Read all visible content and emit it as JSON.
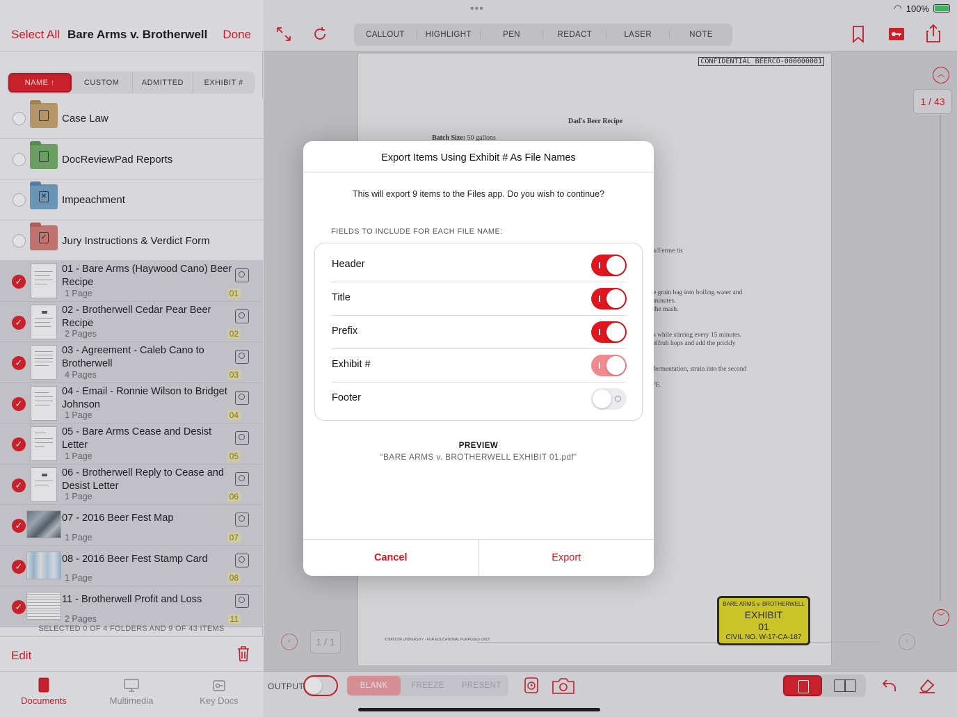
{
  "sidebar": {
    "select_all": "Select All",
    "title": "Bare Arms v. Brotherwell",
    "done": "Done",
    "sort_tabs": [
      "NAME ↑",
      "CUSTOM",
      "ADMITTED",
      "EXHIBIT #"
    ],
    "folders": [
      {
        "name": "Case Law",
        "color": "#c9a46a",
        "icon": "book-icon"
      },
      {
        "name": "DocReviewPad Reports",
        "color": "#6fae62",
        "icon": "report-icon"
      },
      {
        "name": "Impeachment",
        "color": "#6ea3c9",
        "icon": "x-box-icon"
      },
      {
        "name": "Jury Instructions & Verdict Form",
        "color": "#d77a74",
        "icon": "checkbox-icon"
      }
    ],
    "documents": [
      {
        "title": "01 - Bare Arms (Haywood Cano) Beer Recipe",
        "pages": "1 Page",
        "exhibit": "01"
      },
      {
        "title": "02 - Brotherwell Cedar Pear Beer Recipe",
        "pages": "2 Pages",
        "exhibit": "02"
      },
      {
        "title": "03 - Agreement - Caleb Cano to Brotherwell",
        "pages": "4 Pages",
        "exhibit": "03"
      },
      {
        "title": "04 - Email - Ronnie Wilson to Bridget Johnson",
        "pages": "1 Page",
        "exhibit": "04"
      },
      {
        "title": "05 - Bare Arms Cease and Desist Letter",
        "pages": "1 Page",
        "exhibit": "05"
      },
      {
        "title": "06 - Brotherwell Reply to Cease and Desist Letter",
        "pages": "1 Page",
        "exhibit": "06"
      },
      {
        "title": "07 - 2016 Beer Fest Map",
        "pages": "1 Page",
        "exhibit": "07"
      },
      {
        "title": "08 - 2016 Beer Fest Stamp Card",
        "pages": "1 Page",
        "exhibit": "08"
      },
      {
        "title": "11 - Brotherwell Profit and Loss",
        "pages": "2 Pages",
        "exhibit": "11"
      }
    ],
    "selection_status": "SELECTED 0 OF 4 FOLDERS AND 9 OF 43 ITEMS",
    "edit": "Edit",
    "tabs": [
      "Documents",
      "Multimedia",
      "Key Docs"
    ]
  },
  "status_bar": {
    "battery": "100%"
  },
  "toolbar": {
    "tools": [
      "CALLOUT",
      "HIGHLIGHT",
      "PEN",
      "REDACT",
      "LASER",
      "NOTE"
    ]
  },
  "document": {
    "confidential": "CONFIDENTIAL BEERCO-000000001",
    "title": "Dad's Beer Recipe",
    "batch_label": "Batch Size:",
    "batch_value": "50 gallons",
    "fragments": [
      "ps/Ferme  tis",
      "e grain bag into boiling water and",
      "minutes.",
      "the mash.",
      "s while stirring every 15 minutes.",
      "elfruh hops and add the prickly",
      "fermentation, strain into the second",
      "°F."
    ],
    "footer": "© BAYLOR UNIVERSITY - FOR EDUCATIONAL PURPOSES ONLY",
    "stamp": {
      "line1": "BARE ARMS v. BROTHERWELL",
      "line2": "EXHIBIT",
      "line3": "01",
      "line4": "CIVIL NO. W-17-CA-187"
    }
  },
  "viewer": {
    "page_count": "1 / 43",
    "local_page": "1 / 1",
    "output_label": "OUTPUT",
    "present_buttons": [
      "BLANK",
      "FREEZE",
      "PRESENT"
    ]
  },
  "modal": {
    "title": "Export Items Using Exhibit # As File Names",
    "message": "This will export 9 items to the Files app. Do you wish to continue?",
    "fields_label": "FIELDS TO INCLUDE FOR EACH FILE NAME:",
    "fields": [
      {
        "label": "Header",
        "state": "on"
      },
      {
        "label": "Title",
        "state": "on"
      },
      {
        "label": "Prefix",
        "state": "on"
      },
      {
        "label": "Exhibit #",
        "state": "on-disabled"
      },
      {
        "label": "Footer",
        "state": "off"
      }
    ],
    "preview_label": "PREVIEW",
    "preview_value": "“BARE ARMS v. BROTHERWELL   EXHIBIT 01.pdf”",
    "cancel": "Cancel",
    "export": "Export"
  },
  "colors": {
    "accent": "#d9121c",
    "stamp": "#e3dc1b"
  }
}
